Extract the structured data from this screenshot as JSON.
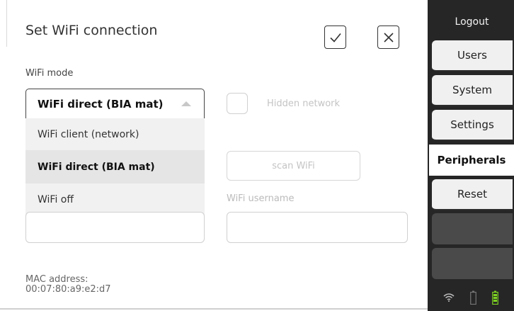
{
  "dialog": {
    "title": "Set WiFi connection",
    "confirm_icon": "checkmark-icon",
    "cancel_icon": "close-icon"
  },
  "wifi_mode": {
    "label": "WiFi mode",
    "selected": "WiFi direct (BIA mat)",
    "options": [
      "WiFi client (network)",
      "WiFi direct (BIA mat)",
      "WiFi off"
    ]
  },
  "hidden_network": {
    "label": "Hidden network",
    "checked": false
  },
  "scan_button": {
    "label": "scan WiFi"
  },
  "wifi_username": {
    "label": "WiFi username",
    "value": ""
  },
  "mac": {
    "label": "MAC address:",
    "value": "00:07:80:a9:e2:d7"
  },
  "sidebar": {
    "logout": "Logout",
    "items": [
      "Users",
      "System",
      "Settings",
      "Peripherals",
      "Reset"
    ],
    "active": "Peripherals"
  },
  "status": {
    "icons": [
      "wifi-icon",
      "empty-battery-icon",
      "charged-battery-icon"
    ],
    "battery_color": "#7ed321"
  }
}
